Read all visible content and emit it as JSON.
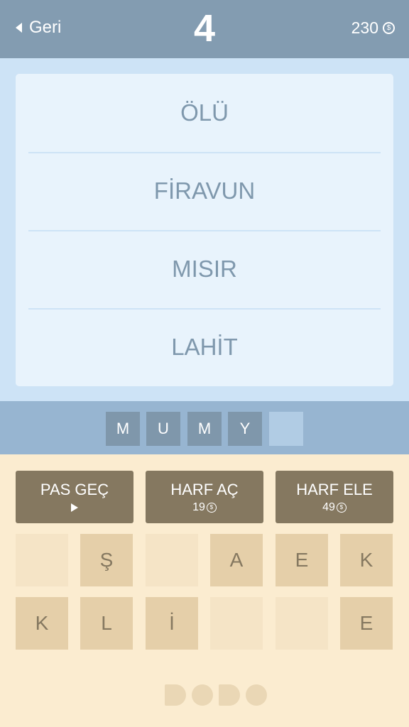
{
  "header": {
    "back_label": "Geri",
    "level": "4",
    "coins": "230",
    "coin_symbol": "$"
  },
  "clues": [
    "ÖLÜ",
    "FİRAVUN",
    "MISIR",
    "LAHİT"
  ],
  "answer": {
    "slots": [
      "M",
      "U",
      "M",
      "Y",
      ""
    ]
  },
  "actions": {
    "skip_label": "PAS GEÇ",
    "reveal_label": "HARF AÇ",
    "reveal_cost": "19",
    "eliminate_label": "HARF ELE",
    "eliminate_cost": "49"
  },
  "letters": {
    "row1": [
      "",
      "Ş",
      "",
      "A",
      "E",
      "K"
    ],
    "row2": [
      "K",
      "L",
      "İ",
      "",
      "",
      "E"
    ]
  },
  "logo": "DODO",
  "colors": {
    "header": "#839cb1",
    "clue_background": "#cde3f6",
    "answer_strip": "#97b5d1",
    "action_button": "#857860",
    "letter_tile": "#e5cfa9",
    "bottom_background": "#fbecd0"
  }
}
